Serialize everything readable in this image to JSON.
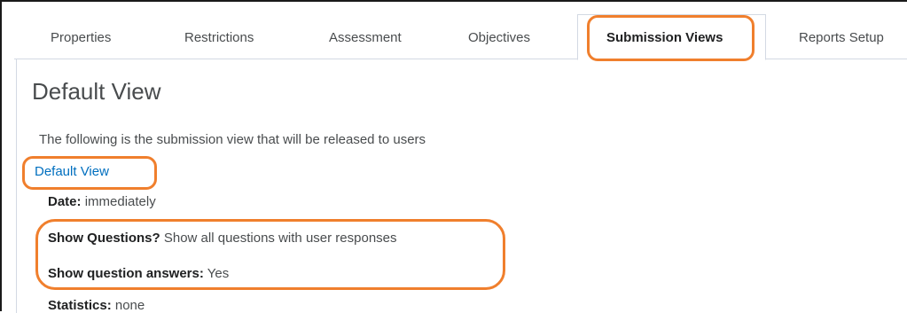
{
  "tabs": [
    {
      "label": "Properties"
    },
    {
      "label": "Restrictions"
    },
    {
      "label": "Assessment"
    },
    {
      "label": "Objectives"
    },
    {
      "label": "Submission Views"
    },
    {
      "label": "Reports Setup"
    }
  ],
  "active_tab": "Submission Views",
  "page": {
    "title": "Default View",
    "description": "The following is the submission view that will be released to users",
    "view_link": "Default View"
  },
  "details": {
    "date_label": "Date:",
    "date_value": "immediately",
    "questions_label": "Show Questions?",
    "questions_value": "Show all questions with user responses",
    "answers_label": "Show question answers:",
    "answers_value": "Yes",
    "statistics_label": "Statistics:",
    "statistics_value": "none"
  },
  "colors": {
    "highlight": "#f07f2d",
    "link": "#006fbf",
    "text": "#494c4e",
    "border": "#d3d9e3"
  }
}
